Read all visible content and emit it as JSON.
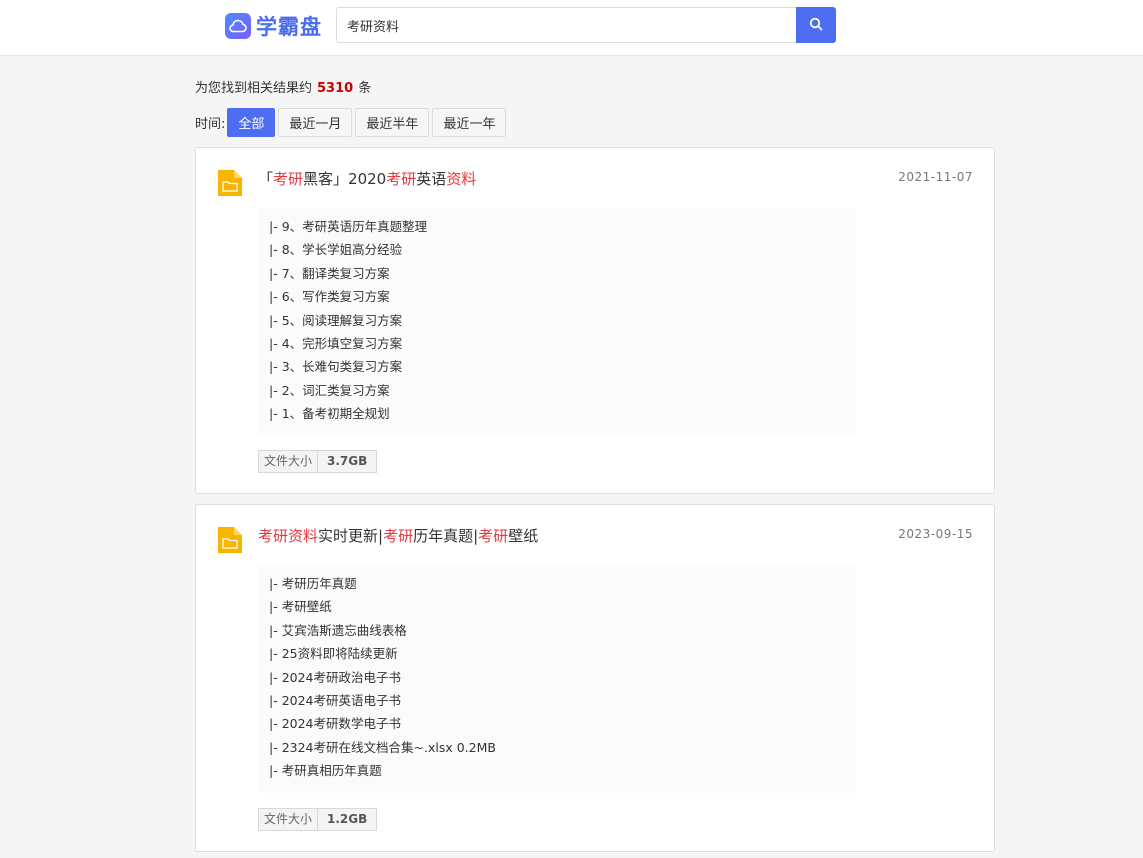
{
  "header": {
    "logo_text": "学霸盘",
    "search_value": "考研资料",
    "search_icon": "search-icon"
  },
  "summary": {
    "prefix": "为您找到相关结果约",
    "count": "5310",
    "suffix": "条"
  },
  "filter": {
    "label": "时间:",
    "options": [
      "全部",
      "最近一月",
      "最近半年",
      "最近一年"
    ],
    "active": "全部"
  },
  "results": [
    {
      "title_parts": [
        {
          "text": "「",
          "hl": false
        },
        {
          "text": "考研",
          "hl": true
        },
        {
          "text": "黑客」2020",
          "hl": false
        },
        {
          "text": "考研",
          "hl": true
        },
        {
          "text": "英语",
          "hl": false
        },
        {
          "text": "资料",
          "hl": true
        }
      ],
      "date": "2021-11-07",
      "files": [
        "|- 9、考研英语历年真题整理",
        "|- 8、学长学姐高分经验",
        "|- 7、翻译类复习方案",
        "|- 6、写作类复习方案",
        "|- 5、阅读理解复习方案",
        "|- 4、完形填空复习方案",
        "|- 3、长难句类复习方案",
        "|- 2、词汇类复习方案",
        "|- 1、备考初期全规划"
      ],
      "size_label": "文件大小",
      "size_value": "3.7GB"
    },
    {
      "title_parts": [
        {
          "text": "考研",
          "hl": true
        },
        {
          "text": "资料",
          "hl": true
        },
        {
          "text": "实时更新|",
          "hl": false
        },
        {
          "text": "考研",
          "hl": true
        },
        {
          "text": "历年真题|",
          "hl": false
        },
        {
          "text": "考研",
          "hl": true
        },
        {
          "text": "壁纸",
          "hl": false
        }
      ],
      "date": "2023-09-15",
      "files": [
        "|- 考研历年真题",
        "|- 考研壁纸",
        "|- 艾宾浩斯遗忘曲线表格",
        "|- 25资料即将陆续更新",
        "|- 2024考研政治电子书",
        "|- 2024考研英语电子书",
        "|- 2024考研数学电子书",
        "|- 2324考研在线文档合集~.xlsx 0.2MB",
        "|- 考研真相历年真题"
      ],
      "size_label": "文件大小",
      "size_value": "1.2GB"
    }
  ],
  "colors": {
    "accent": "#4e6ef2",
    "highlight": "#e4393c",
    "count": "#cc0000",
    "folder": "#f7b500"
  }
}
